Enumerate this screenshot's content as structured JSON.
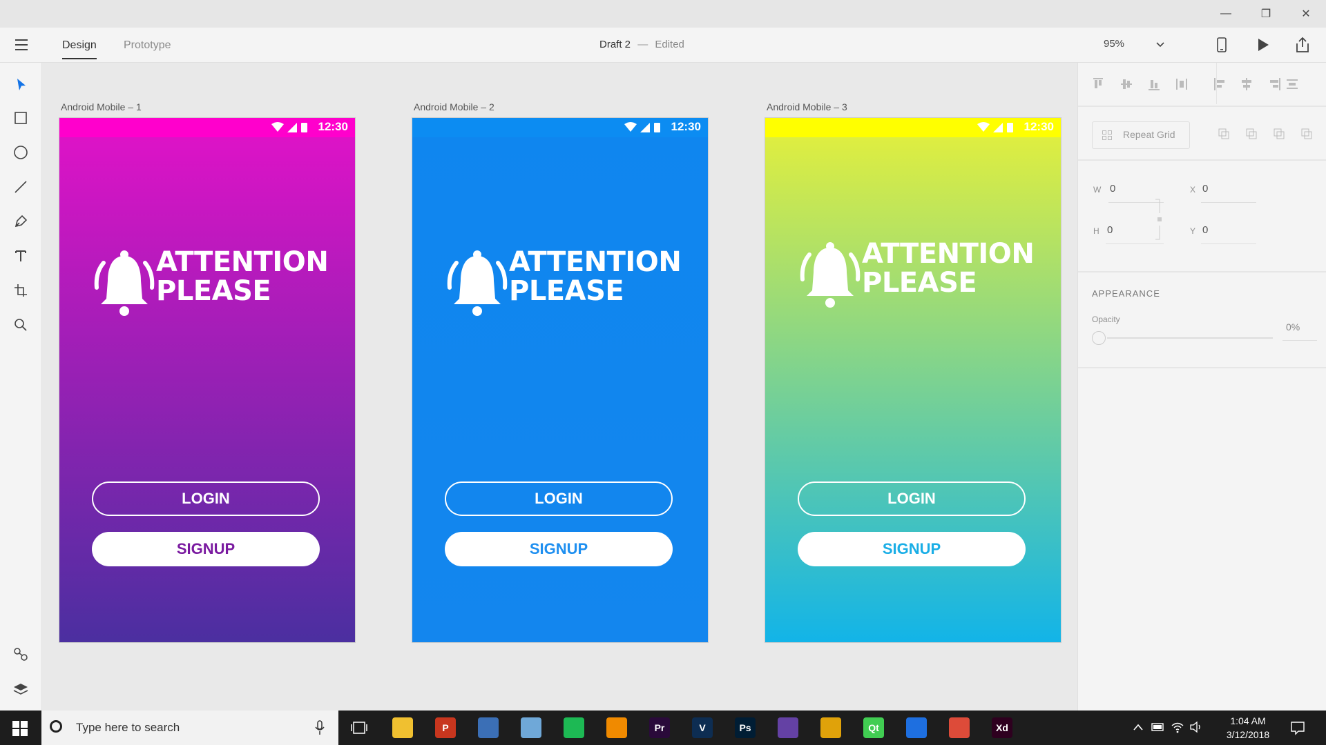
{
  "window": {
    "minimize_glyph": "—",
    "restore_glyph": "❐",
    "close_glyph": "✕"
  },
  "toolbar": {
    "tabs": [
      {
        "label": "Design"
      },
      {
        "label": "Prototype"
      }
    ],
    "doc_title": "Draft 2",
    "doc_sep": "—",
    "doc_status": "Edited",
    "zoom": "95%"
  },
  "artboards": [
    {
      "label": "Android Mobile – 1",
      "time": "12:30",
      "title_line1": "ATTENTION",
      "title_line2": "PLEASE",
      "login": "LOGIN",
      "signup": "SIGNUP",
      "signup_color": "#7a1aa0",
      "status_color": "#ff00cc",
      "grad_top": "#e212c8",
      "grad_bottom": "#4b2fa0"
    },
    {
      "label": "Android Mobile – 2",
      "time": "12:30",
      "title_line1": "ATTENTION",
      "title_line2": "PLEASE",
      "login": "LOGIN",
      "signup": "SIGNUP",
      "signup_color": "#1e8ff0",
      "status_color": "#0c8cf2",
      "grad_top": "#0f86ef",
      "grad_bottom": "#1386ee"
    },
    {
      "label": "Android Mobile – 3",
      "time": "12:30",
      "title_line1": "ATTENTION",
      "title_line2": "PLEASE",
      "login": "LOGIN",
      "signup": "SIGNUP",
      "signup_color": "#1aaee6",
      "status_color": "#ffff00",
      "grad_top": "#e6f03a",
      "grad_bottom": "#12b4e8"
    }
  ],
  "right_panel": {
    "repeat_grid": "Repeat Grid",
    "w_label": "W",
    "w_value": "0",
    "h_label": "H",
    "h_value": "0",
    "x_label": "X",
    "x_value": "0",
    "y_label": "Y",
    "y_value": "0",
    "appearance": "APPEARANCE",
    "opacity_label": "Opacity",
    "opacity_value": "0%"
  },
  "taskbar": {
    "search_placeholder": "Type here to search",
    "time": "1:04 AM",
    "date": "3/12/2018",
    "apps": [
      {
        "name": "file-explorer",
        "glyph": "",
        "color": "#f0c030"
      },
      {
        "name": "papers",
        "glyph": "P",
        "color": "#c8361e"
      },
      {
        "name": "store",
        "glyph": "",
        "color": "#3b6fb6"
      },
      {
        "name": "notes",
        "glyph": "",
        "color": "#6fa8d8"
      },
      {
        "name": "spotify",
        "glyph": "",
        "color": "#1db954"
      },
      {
        "name": "vlc",
        "glyph": "",
        "color": "#f08a00"
      },
      {
        "name": "premiere",
        "glyph": "Pr",
        "color": "#2a0a3a"
      },
      {
        "name": "visio",
        "glyph": "V",
        "color": "#0d2d52"
      },
      {
        "name": "photoshop",
        "glyph": "Ps",
        "color": "#001d34"
      },
      {
        "name": "twitch",
        "glyph": "",
        "color": "#6441a4"
      },
      {
        "name": "layers-app",
        "glyph": "",
        "color": "#e0a20a"
      },
      {
        "name": "qt",
        "glyph": "Qt",
        "color": "#41cd52"
      },
      {
        "name": "maps",
        "glyph": "",
        "color": "#1e6fe0"
      },
      {
        "name": "chrome",
        "glyph": "",
        "color": "#dd4b39"
      },
      {
        "name": "xd",
        "glyph": "Xd",
        "color": "#2e001f"
      }
    ]
  },
  "colors": {
    "accent": "#1473e6",
    "canvas": "#e9e9e9"
  }
}
